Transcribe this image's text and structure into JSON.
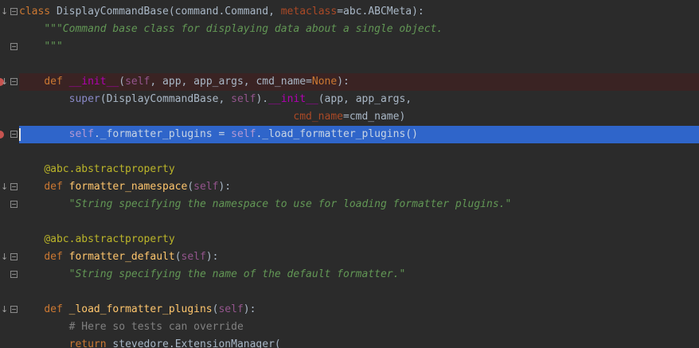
{
  "editor": {
    "lines": [
      {
        "tokens": [
          [
            "k",
            "class "
          ],
          [
            "s",
            "DisplayCommandBase(command.Command, "
          ],
          [
            "p",
            "metaclass"
          ],
          [
            "s",
            "=abc.ABCMeta):"
          ]
        ]
      },
      {
        "tokens": [
          [
            "s",
            "    "
          ],
          [
            "d",
            "\"\"\"Command base class for displaying data about a single object."
          ]
        ]
      },
      {
        "tokens": [
          [
            "s",
            "    "
          ],
          [
            "d",
            "\"\"\""
          ]
        ]
      },
      {
        "tokens": []
      },
      {
        "tokens": [
          [
            "s",
            "    "
          ],
          [
            "k",
            "def "
          ],
          [
            "m",
            "__init__"
          ],
          [
            "s",
            "("
          ],
          [
            "sl",
            "self"
          ],
          [
            "s",
            ", app, app_args, cmd_name="
          ],
          [
            "k",
            "None"
          ],
          [
            "s",
            "):"
          ]
        ]
      },
      {
        "tokens": [
          [
            "s",
            "        "
          ],
          [
            "bi",
            "super"
          ],
          [
            "s",
            "(DisplayCommandBase, "
          ],
          [
            "sl",
            "self"
          ],
          [
            "s",
            ")."
          ],
          [
            "m",
            "__init__"
          ],
          [
            "s",
            "(app, app_args,"
          ]
        ]
      },
      {
        "tokens": [
          [
            "s",
            "                                            "
          ],
          [
            "p",
            "cmd_name"
          ],
          [
            "s",
            "=cmd_name)"
          ]
        ]
      },
      {
        "tokens": [
          [
            "s",
            "        "
          ],
          [
            "sl",
            "self"
          ],
          [
            "s",
            "._formatter_plugins = "
          ],
          [
            "sl",
            "self"
          ],
          [
            "s",
            "._load_formatter_plugins()"
          ]
        ]
      },
      {
        "tokens": []
      },
      {
        "tokens": [
          [
            "s",
            "    "
          ],
          [
            "dec",
            "@abc.abstractproperty"
          ]
        ]
      },
      {
        "tokens": [
          [
            "s",
            "    "
          ],
          [
            "k",
            "def "
          ],
          [
            "f",
            "formatter_namespace"
          ],
          [
            "s",
            "("
          ],
          [
            "sl",
            "self"
          ],
          [
            "s",
            "):"
          ]
        ]
      },
      {
        "tokens": [
          [
            "s",
            "        "
          ],
          [
            "d",
            "\"String specifying the namespace to use for loading formatter plugins.\""
          ]
        ]
      },
      {
        "tokens": []
      },
      {
        "tokens": [
          [
            "s",
            "    "
          ],
          [
            "dec",
            "@abc.abstractproperty"
          ]
        ]
      },
      {
        "tokens": [
          [
            "s",
            "    "
          ],
          [
            "k",
            "def "
          ],
          [
            "f",
            "formatter_default"
          ],
          [
            "s",
            "("
          ],
          [
            "sl",
            "self"
          ],
          [
            "s",
            "):"
          ]
        ]
      },
      {
        "tokens": [
          [
            "s",
            "        "
          ],
          [
            "d",
            "\"String specifying the name of the default formatter.\""
          ]
        ]
      },
      {
        "tokens": []
      },
      {
        "tokens": [
          [
            "s",
            "    "
          ],
          [
            "k",
            "def "
          ],
          [
            "f",
            "_load_formatter_plugins"
          ],
          [
            "s",
            "("
          ],
          [
            "sl",
            "self"
          ],
          [
            "s",
            "):"
          ]
        ]
      },
      {
        "tokens": [
          [
            "s",
            "        "
          ],
          [
            "cm",
            "# Here so tests can override"
          ]
        ]
      },
      {
        "tokens": [
          [
            "s",
            "        "
          ],
          [
            "k",
            "return "
          ],
          [
            "s",
            "stevedore.ExtensionManager("
          ]
        ]
      }
    ],
    "breakpoint_lines": [
      4,
      7
    ],
    "selected_line": 7,
    "caret_line": 7,
    "gutter_markers": {
      "arrow_lines": [
        0,
        4,
        10,
        14,
        17
      ],
      "fold_lines": [
        0,
        2,
        4,
        7,
        10,
        11,
        14,
        15,
        17
      ]
    },
    "colors": {
      "background": "#2b2b2b",
      "selection": "#2f65ca",
      "breakpoint_line": "#3a2323",
      "breakpoint": "#c75450"
    }
  }
}
